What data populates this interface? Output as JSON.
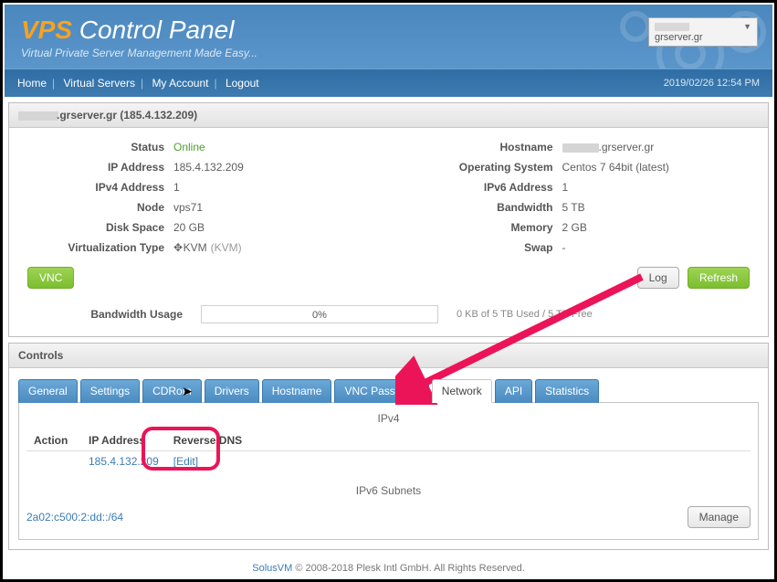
{
  "header": {
    "title_vps": "VPS",
    "title_rest": " Control Panel",
    "subtitle": "Virtual Private Server Management Made Easy...",
    "server_suffix": "grserver.gr"
  },
  "nav": {
    "home": "Home",
    "vservers": "Virtual Servers",
    "account": "My Account",
    "logout": "Logout",
    "datetime": "2019/02/26 12:54 PM"
  },
  "server_panel": {
    "domain_suffix": ".grserver.gr",
    "ip_paren": " (185.4.132.209)",
    "left": {
      "status_k": "Status",
      "status_v": "Online",
      "ip_k": "IP Address",
      "ip_v": "185.4.132.209",
      "ipv4_k": "IPv4 Address",
      "ipv4_v": "1",
      "node_k": "Node",
      "node_v": "vps71",
      "disk_k": "Disk Space",
      "disk_v": "20 GB",
      "vt_k": "Virtualization Type",
      "vt_v": "KVM",
      "vt_sub": "(KVM)"
    },
    "right": {
      "host_k": "Hostname",
      "host_suffix": ".grserver.gr",
      "os_k": "Operating System",
      "os_v": "Centos 7 64bit (latest)",
      "ipv6_k": "IPv6 Address",
      "ipv6_v": "1",
      "bw_k": "Bandwidth",
      "bw_v": "5 TB",
      "mem_k": "Memory",
      "mem_v": "2 GB",
      "swap_k": "Swap",
      "swap_v": "-"
    },
    "buttons": {
      "vnc": "VNC",
      "log": "Log",
      "refresh": "Refresh"
    },
    "bw_usage": {
      "label": "Bandwidth Usage",
      "pct": "0%",
      "text": "0 KB of 5 TB Used / 5 TB Free"
    }
  },
  "controls": {
    "title": "Controls",
    "tabs": [
      "General",
      "Settings",
      "CDRom",
      "Drivers",
      "Hostname",
      "VNC Password",
      "Network",
      "API",
      "Statistics"
    ],
    "active_tab_index": 6,
    "ipv4": {
      "title": "IPv4",
      "headers": [
        "Action",
        "IP Address",
        "Reverse DNS"
      ],
      "row": {
        "action": "",
        "ip": "185.4.132.209",
        "rdns": "[Edit]"
      }
    },
    "ipv6": {
      "title": "IPv6 Subnets",
      "subnet": "2a02:c500:2:dd::/64",
      "manage": "Manage"
    }
  },
  "footer": {
    "brand": "SolusVM",
    "rest": " © 2008-2018 Plesk Intl GmbH. All Rights Reserved."
  },
  "colors": {
    "accent_pink": "#ec1458",
    "accent_green": "#7cbe2f",
    "accent_blue": "#4a8bc1"
  }
}
